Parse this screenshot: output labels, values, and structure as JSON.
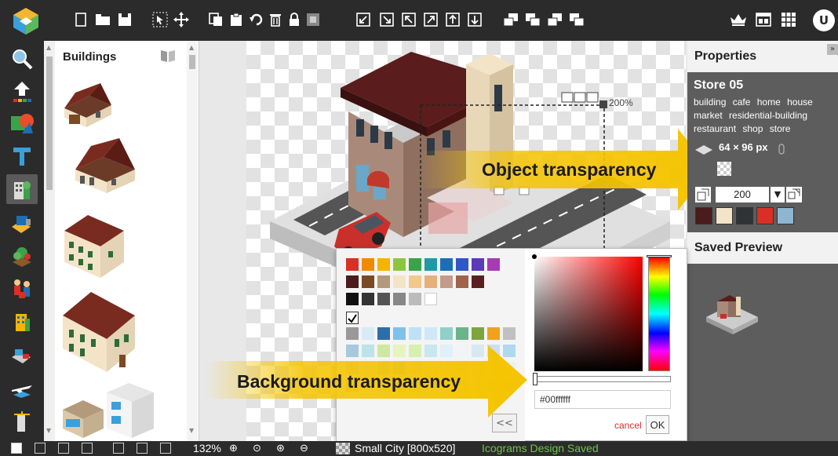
{
  "app": {
    "user_initial": "U"
  },
  "library": {
    "title": "Buildings",
    "items": [
      "building-1",
      "building-2",
      "building-3",
      "building-4",
      "building-5"
    ]
  },
  "properties": {
    "title": "Properties",
    "object_name": "Store 05",
    "tags": [
      "building",
      "cafe",
      "home",
      "house",
      "market",
      "residential-building",
      "restaurant",
      "shop",
      "store"
    ],
    "size": "64 × 96 px",
    "zoom": "200",
    "colors": [
      "#4a1c1c",
      "#f3e4c8",
      "#2f3336",
      "#d93025",
      "#8fb6d0"
    ],
    "saved_preview_title": "Saved Preview"
  },
  "canvas": {
    "zoom_badge": "200%",
    "callout_object": "Object transparency",
    "callout_background": "Background transparency"
  },
  "color_picker": {
    "hex_value": "#00ffffff",
    "cancel_label": "cancel",
    "ok_label": "OK",
    "back_label": "<<",
    "palette_rows": [
      [
        "#d93025",
        "#f08a00",
        "#f5b400",
        "#8cc63f",
        "#3aa34a",
        "#1f9aa5",
        "#1a6fb5",
        "#2e57c7",
        "#5b3bb7",
        "#a83ab5"
      ],
      [
        "#4a1c1c",
        "#7a4a22",
        "#b39a7a",
        "#f3e4c8",
        "#f2c98a",
        "#e6b07a",
        "#c49a8a",
        "#a0624a",
        "#5a2020"
      ],
      [
        "#111111",
        "#333333",
        "#555555",
        "#888888",
        "#bbbbbb",
        "#ffffff"
      ],
      [
        "#999999",
        "#d8eaf6",
        "#2d6ea8",
        "#7fc1e8",
        "#bfe1f6",
        "#cfe8f8",
        "#8fd0c9",
        "#6bb38a",
        "#7ea53c",
        "#f0a21a",
        "#c0c0c0"
      ],
      [
        "#a7c9dc",
        "#bde3e6",
        "#cde8a0",
        "#e8f4c0",
        "#d7f0b0",
        "#c8e8f0",
        "#e0f0f8",
        "#f0f4f6",
        "#d8e8f0",
        "#c8e0f0",
        "#b0d8f0"
      ],
      [
        "#d0d0d0",
        "#e8e8e8",
        "#a8e0d8",
        "#90d0f0",
        "#c0e8f8",
        "#e0f4f8",
        "#f4f4f4",
        "#dce8f0",
        "#e0e8e8",
        "#f0f0f0",
        "#e8f0f4"
      ],
      [
        "#b8d888",
        "#e8f0d8",
        "#d8f0f8",
        "#c0e0f0",
        "#a8d8f0",
        "#e8f4fa",
        "#f8f8f8",
        "#e8e8e8",
        "#f0f4f8",
        "#d8e4ec",
        "#ccd8e0"
      ]
    ]
  },
  "status": {
    "zoom": "132%",
    "document": "Small City [800x520]",
    "save_status": "Icograms Design Saved",
    "save_color": "#6cc644"
  }
}
